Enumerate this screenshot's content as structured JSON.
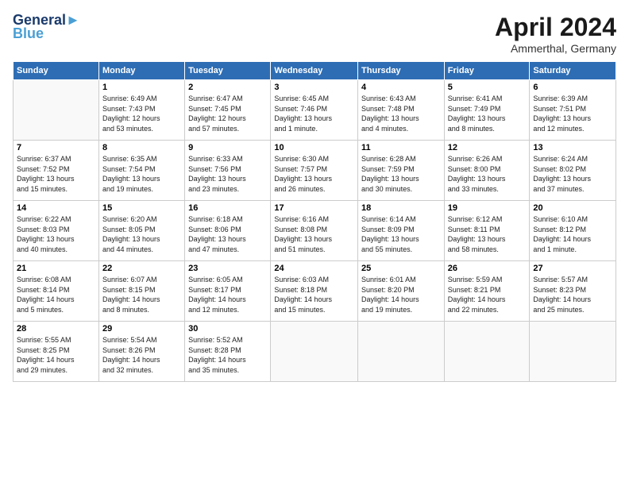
{
  "header": {
    "logo_line1": "General",
    "logo_line2": "Blue",
    "month": "April 2024",
    "location": "Ammerthal, Germany"
  },
  "weekdays": [
    "Sunday",
    "Monday",
    "Tuesday",
    "Wednesday",
    "Thursday",
    "Friday",
    "Saturday"
  ],
  "weeks": [
    [
      {
        "day": "",
        "info": ""
      },
      {
        "day": "1",
        "info": "Sunrise: 6:49 AM\nSunset: 7:43 PM\nDaylight: 12 hours\nand 53 minutes."
      },
      {
        "day": "2",
        "info": "Sunrise: 6:47 AM\nSunset: 7:45 PM\nDaylight: 12 hours\nand 57 minutes."
      },
      {
        "day": "3",
        "info": "Sunrise: 6:45 AM\nSunset: 7:46 PM\nDaylight: 13 hours\nand 1 minute."
      },
      {
        "day": "4",
        "info": "Sunrise: 6:43 AM\nSunset: 7:48 PM\nDaylight: 13 hours\nand 4 minutes."
      },
      {
        "day": "5",
        "info": "Sunrise: 6:41 AM\nSunset: 7:49 PM\nDaylight: 13 hours\nand 8 minutes."
      },
      {
        "day": "6",
        "info": "Sunrise: 6:39 AM\nSunset: 7:51 PM\nDaylight: 13 hours\nand 12 minutes."
      }
    ],
    [
      {
        "day": "7",
        "info": "Sunrise: 6:37 AM\nSunset: 7:52 PM\nDaylight: 13 hours\nand 15 minutes."
      },
      {
        "day": "8",
        "info": "Sunrise: 6:35 AM\nSunset: 7:54 PM\nDaylight: 13 hours\nand 19 minutes."
      },
      {
        "day": "9",
        "info": "Sunrise: 6:33 AM\nSunset: 7:56 PM\nDaylight: 13 hours\nand 23 minutes."
      },
      {
        "day": "10",
        "info": "Sunrise: 6:30 AM\nSunset: 7:57 PM\nDaylight: 13 hours\nand 26 minutes."
      },
      {
        "day": "11",
        "info": "Sunrise: 6:28 AM\nSunset: 7:59 PM\nDaylight: 13 hours\nand 30 minutes."
      },
      {
        "day": "12",
        "info": "Sunrise: 6:26 AM\nSunset: 8:00 PM\nDaylight: 13 hours\nand 33 minutes."
      },
      {
        "day": "13",
        "info": "Sunrise: 6:24 AM\nSunset: 8:02 PM\nDaylight: 13 hours\nand 37 minutes."
      }
    ],
    [
      {
        "day": "14",
        "info": "Sunrise: 6:22 AM\nSunset: 8:03 PM\nDaylight: 13 hours\nand 40 minutes."
      },
      {
        "day": "15",
        "info": "Sunrise: 6:20 AM\nSunset: 8:05 PM\nDaylight: 13 hours\nand 44 minutes."
      },
      {
        "day": "16",
        "info": "Sunrise: 6:18 AM\nSunset: 8:06 PM\nDaylight: 13 hours\nand 47 minutes."
      },
      {
        "day": "17",
        "info": "Sunrise: 6:16 AM\nSunset: 8:08 PM\nDaylight: 13 hours\nand 51 minutes."
      },
      {
        "day": "18",
        "info": "Sunrise: 6:14 AM\nSunset: 8:09 PM\nDaylight: 13 hours\nand 55 minutes."
      },
      {
        "day": "19",
        "info": "Sunrise: 6:12 AM\nSunset: 8:11 PM\nDaylight: 13 hours\nand 58 minutes."
      },
      {
        "day": "20",
        "info": "Sunrise: 6:10 AM\nSunset: 8:12 PM\nDaylight: 14 hours\nand 1 minute."
      }
    ],
    [
      {
        "day": "21",
        "info": "Sunrise: 6:08 AM\nSunset: 8:14 PM\nDaylight: 14 hours\nand 5 minutes."
      },
      {
        "day": "22",
        "info": "Sunrise: 6:07 AM\nSunset: 8:15 PM\nDaylight: 14 hours\nand 8 minutes."
      },
      {
        "day": "23",
        "info": "Sunrise: 6:05 AM\nSunset: 8:17 PM\nDaylight: 14 hours\nand 12 minutes."
      },
      {
        "day": "24",
        "info": "Sunrise: 6:03 AM\nSunset: 8:18 PM\nDaylight: 14 hours\nand 15 minutes."
      },
      {
        "day": "25",
        "info": "Sunrise: 6:01 AM\nSunset: 8:20 PM\nDaylight: 14 hours\nand 19 minutes."
      },
      {
        "day": "26",
        "info": "Sunrise: 5:59 AM\nSunset: 8:21 PM\nDaylight: 14 hours\nand 22 minutes."
      },
      {
        "day": "27",
        "info": "Sunrise: 5:57 AM\nSunset: 8:23 PM\nDaylight: 14 hours\nand 25 minutes."
      }
    ],
    [
      {
        "day": "28",
        "info": "Sunrise: 5:55 AM\nSunset: 8:25 PM\nDaylight: 14 hours\nand 29 minutes."
      },
      {
        "day": "29",
        "info": "Sunrise: 5:54 AM\nSunset: 8:26 PM\nDaylight: 14 hours\nand 32 minutes."
      },
      {
        "day": "30",
        "info": "Sunrise: 5:52 AM\nSunset: 8:28 PM\nDaylight: 14 hours\nand 35 minutes."
      },
      {
        "day": "",
        "info": ""
      },
      {
        "day": "",
        "info": ""
      },
      {
        "day": "",
        "info": ""
      },
      {
        "day": "",
        "info": ""
      }
    ]
  ]
}
